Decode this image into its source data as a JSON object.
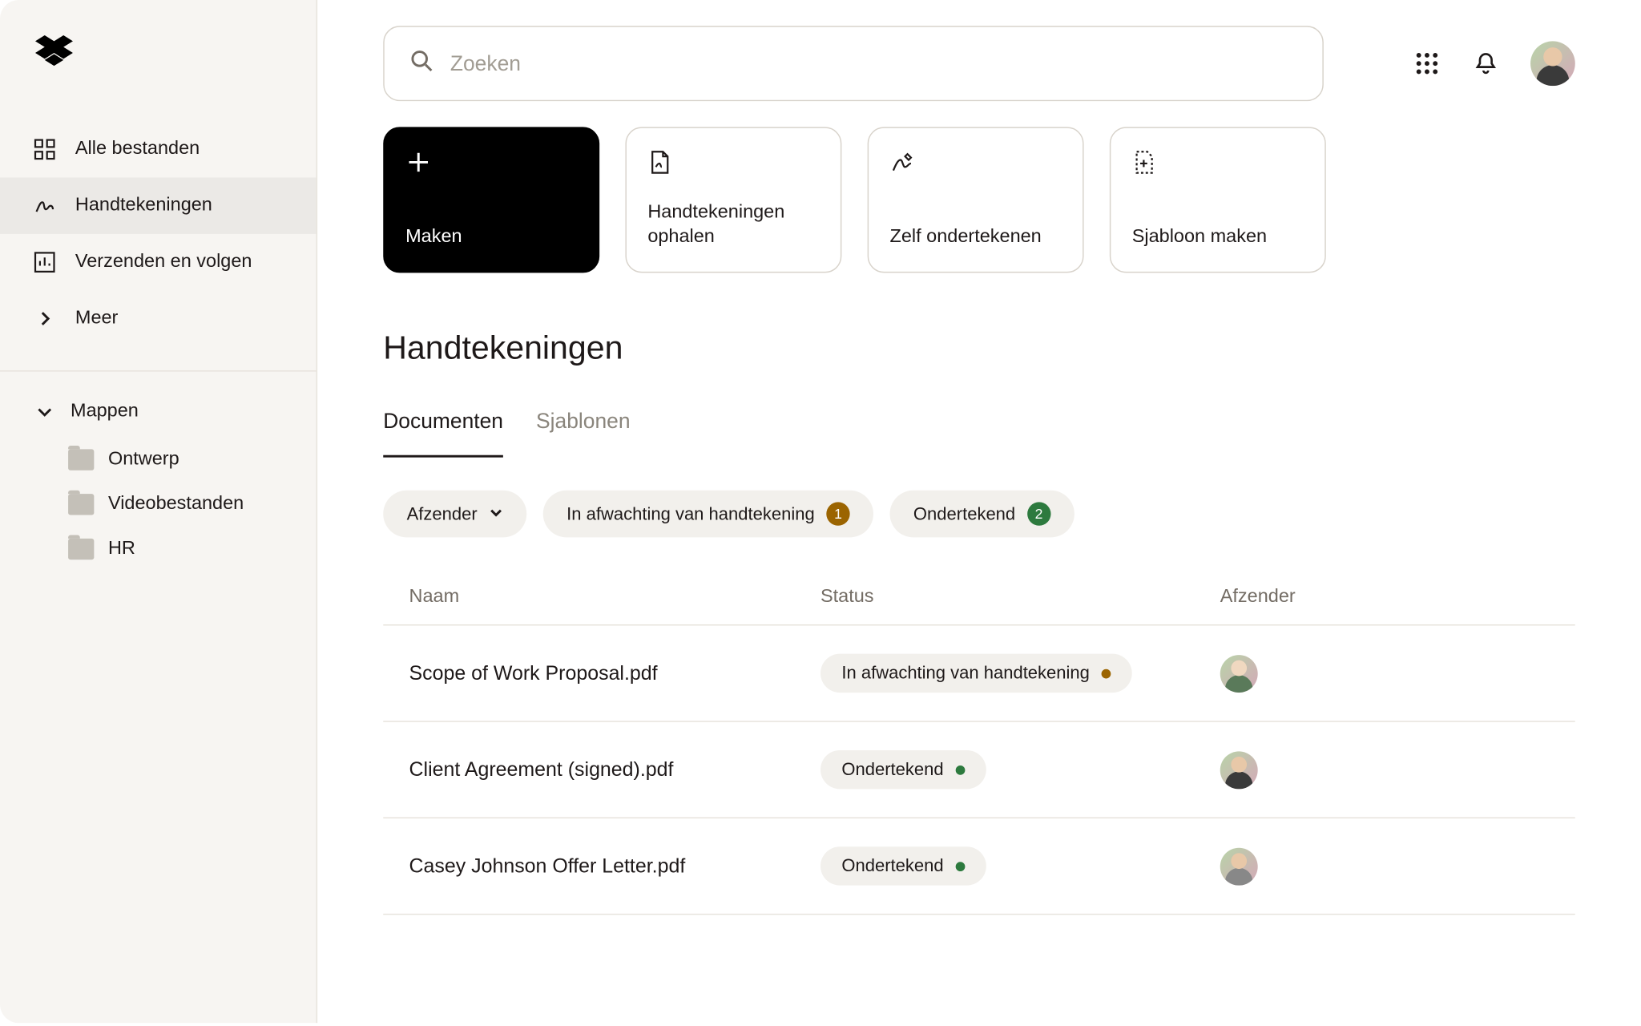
{
  "search": {
    "placeholder": "Zoeken"
  },
  "sidebar": {
    "items": [
      {
        "label": "Alle bestanden"
      },
      {
        "label": "Handtekeningen"
      },
      {
        "label": "Verzenden en volgen"
      },
      {
        "label": "Meer"
      }
    ],
    "folders_header": "Mappen",
    "folders": [
      {
        "label": "Ontwerp"
      },
      {
        "label": "Videobestanden"
      },
      {
        "label": "HR"
      }
    ]
  },
  "actions": [
    {
      "label": "Maken"
    },
    {
      "label": "Handtekeningen ophalen"
    },
    {
      "label": "Zelf ondertekenen"
    },
    {
      "label": "Sjabloon maken"
    }
  ],
  "page_title": "Handtekeningen",
  "tabs": [
    {
      "label": "Documenten"
    },
    {
      "label": "Sjablonen"
    }
  ],
  "filters": {
    "sender_label": "Afzender",
    "awaiting": {
      "label": "In afwachting van handtekening",
      "count": "1"
    },
    "signed": {
      "label": "Ondertekend",
      "count": "2"
    }
  },
  "table": {
    "headers": {
      "name": "Naam",
      "status": "Status",
      "sender": "Afzender"
    },
    "rows": [
      {
        "name": "Scope of Work Proposal.pdf",
        "status": "In afwachting van handtekening",
        "status_kind": "orange"
      },
      {
        "name": "Client Agreement (signed).pdf",
        "status": "Ondertekend",
        "status_kind": "green"
      },
      {
        "name": "Casey Johnson Offer Letter.pdf",
        "status": "Ondertekend",
        "status_kind": "green"
      }
    ]
  }
}
